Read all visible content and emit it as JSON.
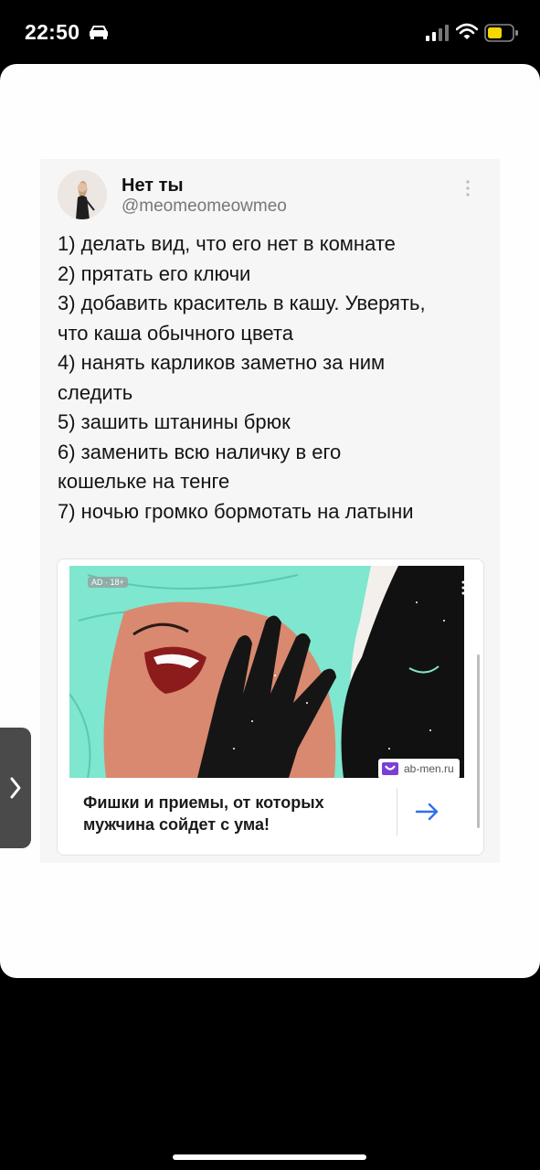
{
  "status_bar": {
    "time": "22:50",
    "icons": [
      "car-icon",
      "signal-icon",
      "wifi-icon",
      "battery-icon"
    ],
    "battery_color": "#f5d600"
  },
  "tweet": {
    "display_name": "Нет ты",
    "handle": "@meomeomeowmeo",
    "lines": [
      "1) делать вид, что его нет в комнате",
      "2) прятать его ключи",
      "3) добавить краситель в кашу. Уверять,",
      "что каша обычного цвета",
      "4) нанять карликов заметно за ним",
      "следить",
      "5) зашить штанины брюк",
      "6) заменить всю наличку в его",
      "кошельке на тенге",
      "7) ночью громко  бормотать на латыни"
    ]
  },
  "ad": {
    "age_badge": "AD · 18+",
    "source": "ab-men.ru",
    "headline_line1": "Фишки и приемы, от которых",
    "headline_line2": "мужчина сойдет с ума!",
    "arrow_icon": "arrow-right-icon",
    "colors": {
      "hair": "#7fe6cf",
      "skin": "#d9896f",
      "night": "#111111",
      "logo": "#7b3fd6"
    }
  },
  "side_tab": {
    "icon": "chevron-right-icon"
  }
}
